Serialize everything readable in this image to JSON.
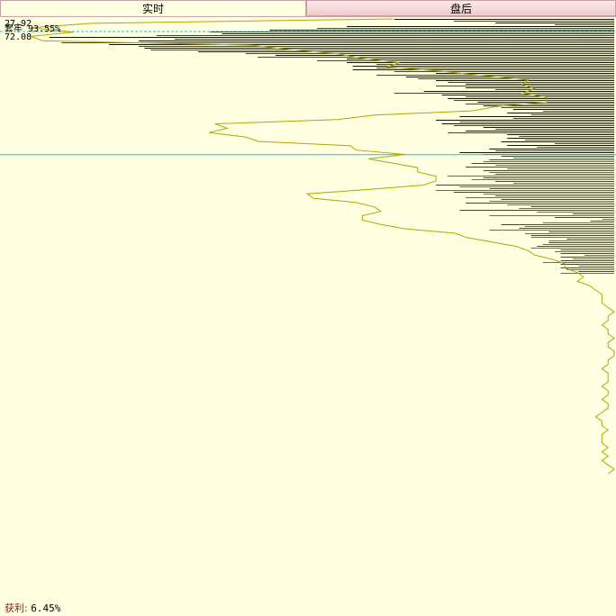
{
  "tabs": {
    "realtime_label": "实时",
    "after_hours_label": "盘后"
  },
  "labels": {
    "price_top": "27.92",
    "price_bottom": "72.08",
    "ratio_text": "套牢 93.55%",
    "profit_key": "获利:",
    "profit_value": "6.45%"
  },
  "colors": {
    "background": "#ffffe1",
    "upper_bar_a": "#00008b",
    "upper_bar_b": "#9400d3",
    "lower_bar_a": "#9400d3",
    "lower_bar_b": "#ff1493",
    "curve": "#b0a800",
    "price_line": "#00ccee"
  },
  "chart_data": {
    "type": "bar",
    "orientation": "horizontal",
    "y_axis": "price level (top = high, bottom = low)",
    "bar_values_relative": [
      0.37,
      0.27,
      0.2,
      0.1,
      0.45,
      0.5,
      0.58,
      0.68,
      0.66,
      0.77,
      0.95,
      0.74,
      0.8,
      0.93,
      0.85,
      0.8,
      0.79,
      0.78,
      0.7,
      0.62,
      0.57,
      0.6,
      0.45,
      0.5,
      0.45,
      0.4,
      0.44,
      0.4,
      0.44,
      0.37,
      0.3,
      0.4,
      0.35,
      0.33,
      0.3,
      0.28,
      0.25,
      0.3,
      0.25,
      0.2,
      0.32,
      0.37,
      0.29,
      0.25,
      0.28,
      0.27,
      0.23,
      0.25,
      0.22,
      0.19,
      0.17,
      0.12,
      0.18,
      0.14,
      0.26,
      0.17,
      0.3,
      0.26,
      0.29,
      0.27,
      0.22,
      0.2,
      0.25,
      0.28,
      0.18,
      0.16,
      0.18,
      0.15,
      0.19,
      0.1,
      0.18,
      0.13,
      0.21,
      0.2,
      0.26,
      0.22,
      0.19,
      0.17,
      0.21,
      0.22,
      0.24,
      0.2,
      0.25,
      0.18,
      0.22,
      0.21,
      0.2,
      0.28,
      0.22,
      0.24,
      0.2,
      0.17,
      0.3,
      0.26,
      0.21,
      0.3,
      0.27,
      0.22,
      0.2,
      0.25,
      0.19,
      0.21,
      0.25,
      0.18,
      0.14,
      0.16,
      0.26,
      0.13,
      0.07,
      0.21,
      0.1,
      0.02,
      0.04,
      0.12,
      0.19,
      0.15,
      0.16,
      0.21,
      0.11,
      0.15,
      0.14,
      0.14,
      0.08,
      0.11,
      0.11,
      0.12,
      0.13,
      0.14,
      0.09,
      0.1,
      0.09,
      0.05,
      0.09,
      0.07,
      0.09,
      0.12,
      0.09,
      0.06,
      0.09,
      0.08,
      0.06,
      0.09
    ],
    "upper_share_percent": 93.55,
    "lower_share_percent": 6.45,
    "curve_relative_x": [
      0.64,
      0.15,
      0.05,
      0.12,
      0.05,
      0.07,
      0.41,
      0.47,
      0.55,
      0.59,
      0.65,
      0.63,
      0.72,
      0.79,
      0.86,
      0.85,
      0.87,
      0.85,
      0.89,
      0.89,
      0.81,
      0.77,
      0.61,
      0.55,
      0.35,
      0.37,
      0.34,
      0.4,
      0.42,
      0.57,
      0.58,
      0.66,
      0.6,
      0.64,
      0.68,
      0.68,
      0.71,
      0.71,
      0.69,
      0.6,
      0.5,
      0.51,
      0.58,
      0.61,
      0.62,
      0.59,
      0.59,
      0.62,
      0.66,
      0.74,
      0.76,
      0.8,
      0.84,
      0.86,
      0.87,
      0.9,
      0.92,
      0.92,
      0.94,
      0.95,
      0.94,
      0.96,
      0.97,
      0.98,
      0.98,
      0.98,
      0.99,
      1.0,
      0.99,
      0.99,
      0.98,
      0.99,
      0.99,
      1.0,
      0.99,
      0.99,
      1.0,
      1.0,
      0.99,
      0.99,
      0.98,
      0.99,
      0.99,
      0.99,
      0.98,
      0.99,
      0.99,
      0.98,
      0.99,
      0.99,
      0.98,
      0.97,
      0.98,
      0.98,
      0.99,
      0.98,
      0.98,
      0.98,
      0.99,
      0.98,
      0.99,
      0.98,
      0.99,
      1.0,
      0.99
    ],
    "price_split_fraction": 0.531,
    "cost_line_fraction": 0.028
  }
}
